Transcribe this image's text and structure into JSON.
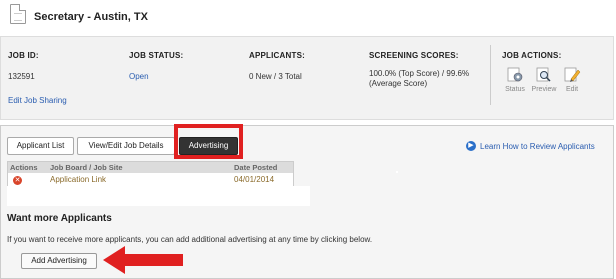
{
  "job": {
    "title": "Secretary - Austin, TX"
  },
  "summary": {
    "job_id_label": "JOB ID:",
    "job_id_value": "132591",
    "status_label": "JOB STATUS:",
    "status_value": "Open",
    "applicants_label": "APPLICANTS:",
    "applicants_value": "0 New / 3 Total",
    "scores_label": "SCREENING SCORES:",
    "scores_line1": "100.0% (Top Score) / 99.6%",
    "scores_line2": "(Average Score)",
    "actions_label": "JOB ACTIONS:",
    "edit_sharing": "Edit Job Sharing",
    "actions": [
      {
        "label": "Status",
        "icon": "status-gear-icon"
      },
      {
        "label": "Preview",
        "icon": "preview-magnifier-icon"
      },
      {
        "label": "Edit",
        "icon": "edit-pencil-icon"
      }
    ]
  },
  "tabs": {
    "applicant_list": "Applicant List",
    "view_edit": "View/Edit Job Details",
    "advertising": "Advertising"
  },
  "help_link": "Learn How to Review Applicants",
  "ad_table": {
    "headers": [
      "Actions",
      "Job Board / Job Site",
      "Date Posted"
    ],
    "rows": [
      {
        "site": "Application Link",
        "date": "04/01/2014"
      }
    ]
  },
  "more": {
    "title": "Want more Applicants",
    "text": "If you want to receive more applicants, you can add additional advertising at any time by clicking below.",
    "button": "Add Advertising"
  },
  "colors": {
    "accent": "#2a5db0",
    "highlight": "#e02020",
    "tab_active": "#333333"
  }
}
